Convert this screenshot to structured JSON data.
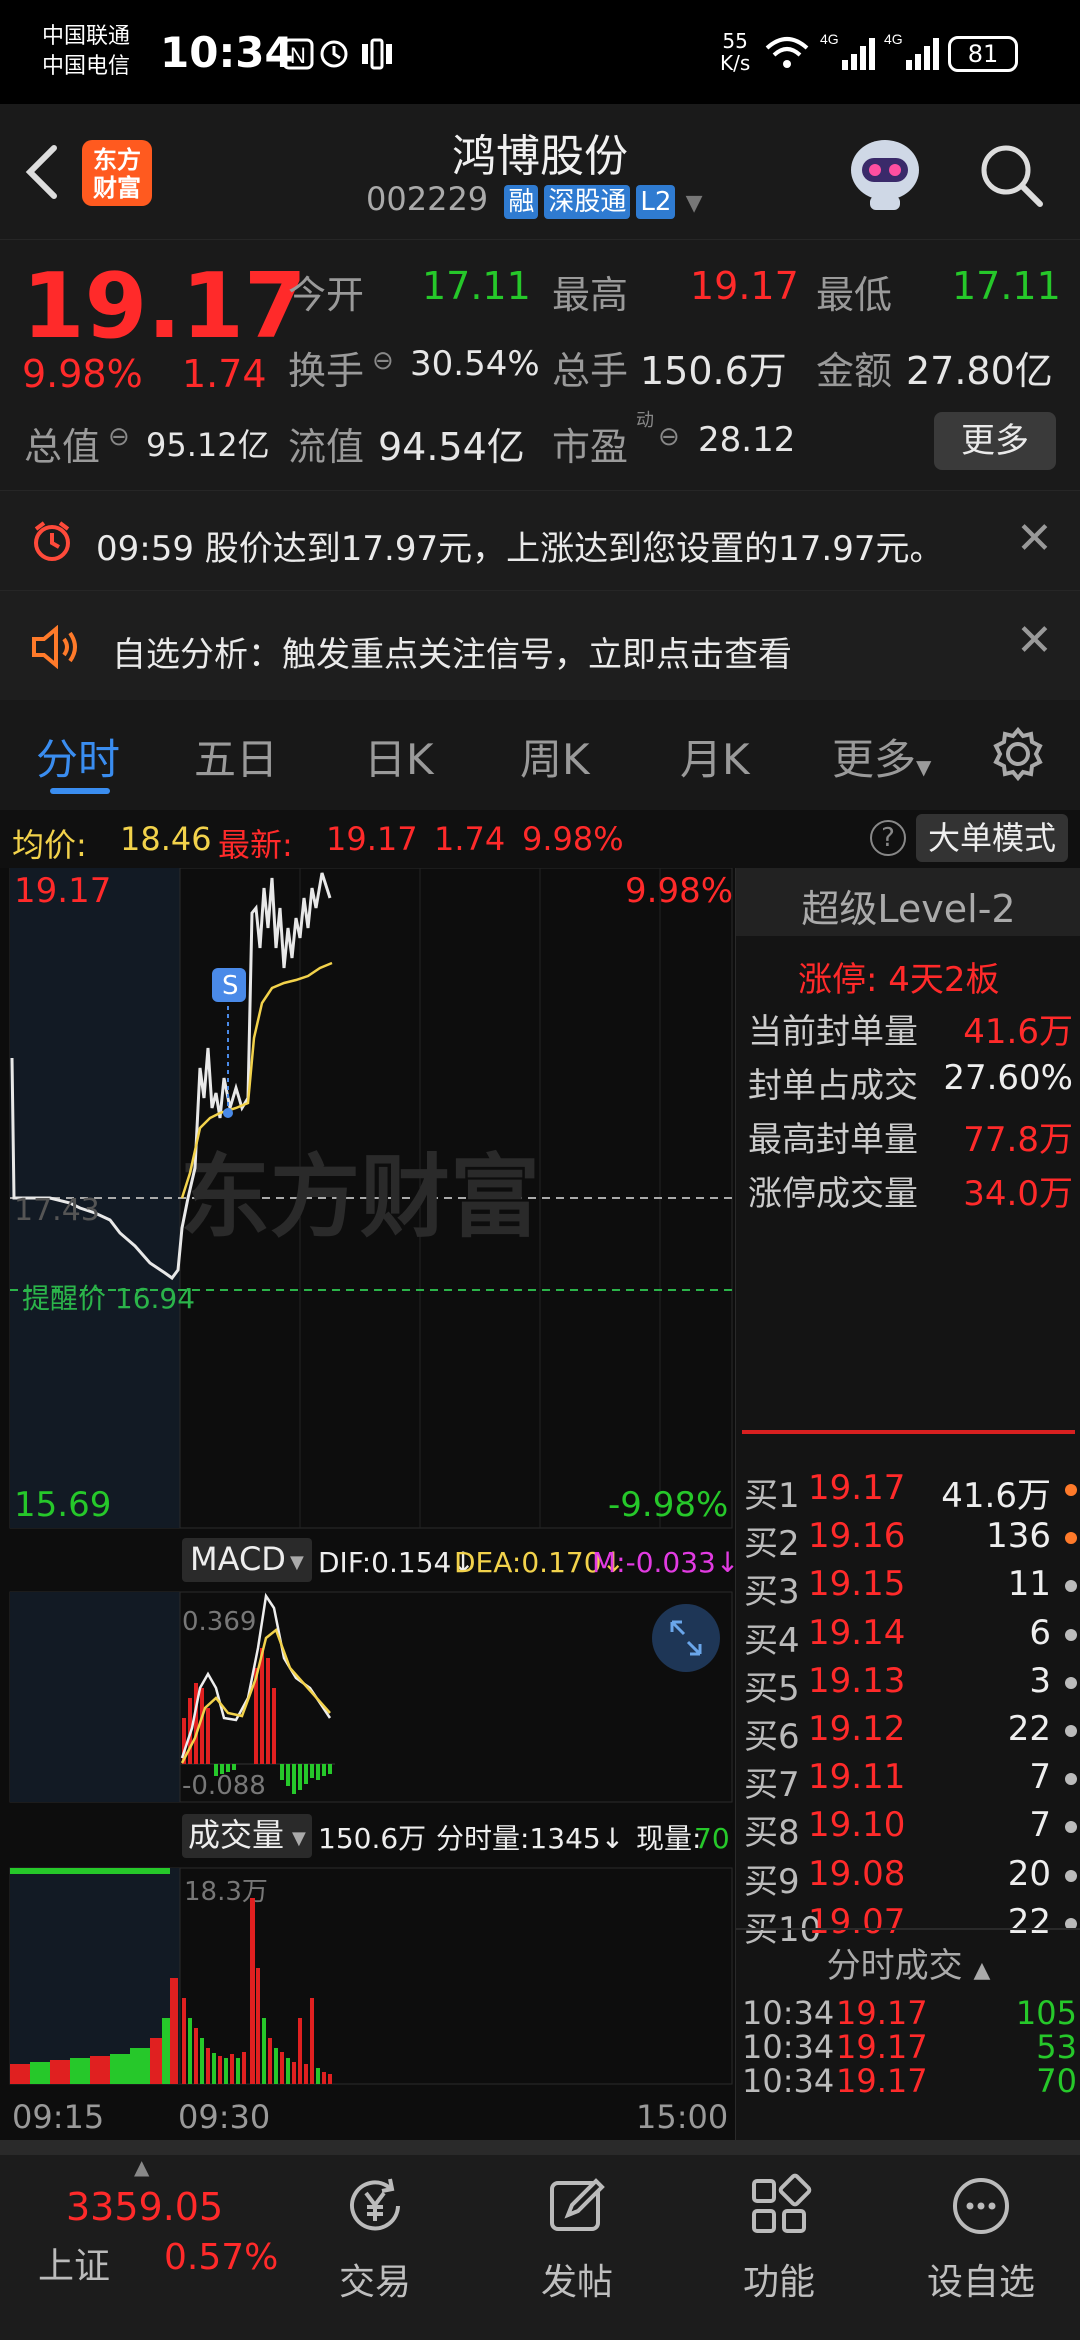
{
  "status_bar": {
    "carrier1": "中国联通",
    "carrier2": "中国电信",
    "time": "10:34",
    "net_speed_value": "55",
    "net_speed_unit": "K/s",
    "battery": "81"
  },
  "header": {
    "logo_line1": "东方",
    "logo_line2": "财富",
    "stock_name": "鸿博股份",
    "stock_code": "002229",
    "tags": [
      "融",
      "深股通",
      "L2"
    ]
  },
  "quote": {
    "price": "19.17",
    "change_pct": "9.98%",
    "change_amt": "1.74",
    "open_label": "今开",
    "open": "17.11",
    "high_label": "最高",
    "high": "19.17",
    "low_label": "最低",
    "low": "17.11",
    "turnover_label": "换手",
    "turnover": "30.54%",
    "volume_label": "总手",
    "volume": "150.6万",
    "amount_label": "金额",
    "amount": "27.80亿",
    "total_mv_label": "总值",
    "total_mv": "95.12亿",
    "float_mv_label": "流值",
    "float_mv": "94.54亿",
    "pe_label": "市盈",
    "pe_sup": "动",
    "pe": "28.12",
    "more_label": "更多"
  },
  "alerts": {
    "price_alert": "09:59 股价达到17.97元，上涨达到您设置的17.97元。",
    "analysis_alert": "自选分析：触发重点关注信号，立即点击查看"
  },
  "tabs": [
    "分时",
    "五日",
    "日K",
    "周K",
    "月K",
    "更多"
  ],
  "infoline": {
    "avg_label": "均价:",
    "avg": "18.46",
    "latest_label": "最新:",
    "latest": "19.17",
    "latest_chg": "1.74",
    "latest_pct": "9.98%",
    "mode_button": "大单模式"
  },
  "chart": {
    "top_price": "19.17",
    "top_pct": "9.98%",
    "bottom_price": "15.69",
    "bottom_pct": "-9.98%",
    "prev_close": "17.43",
    "remind_label": "提醒价 16.94",
    "s_marker": "S",
    "watermark": "东方财富",
    "macd_label": "MACD",
    "dif": "DIF:0.154↓",
    "dea": "DEA:0.170↓",
    "m": "M:-0.033↓",
    "macd_top": "0.369",
    "macd_bottom": "-0.088",
    "vol_label": "成交量",
    "vol_total": "150.6万",
    "vol_minute": "分时量:1345↓",
    "vol_now_label": "现量:",
    "vol_now": "70",
    "vol_max": "18.3万",
    "time_start": "09:15",
    "time_mid": "09:30",
    "time_end": "15:00"
  },
  "level2": {
    "title": "超级Level-2",
    "limit_up": "涨停:  4天2板",
    "rows": [
      {
        "label": "当前封单量",
        "value": "41.6万"
      },
      {
        "label": "封单占成交",
        "value": "27.60%"
      },
      {
        "label": "最高封单量",
        "value": "77.8万"
      },
      {
        "label": "涨停成交量",
        "value": "34.0万"
      }
    ]
  },
  "order_book": [
    {
      "label": "买1",
      "price": "19.17",
      "vol": "41.6万"
    },
    {
      "label": "买2",
      "price": "19.16",
      "vol": "136"
    },
    {
      "label": "买3",
      "price": "19.15",
      "vol": "11"
    },
    {
      "label": "买4",
      "price": "19.14",
      "vol": "6"
    },
    {
      "label": "买5",
      "price": "19.13",
      "vol": "3"
    },
    {
      "label": "买6",
      "price": "19.12",
      "vol": "22"
    },
    {
      "label": "买7",
      "price": "19.11",
      "vol": "7"
    },
    {
      "label": "买8",
      "price": "19.10",
      "vol": "7"
    },
    {
      "label": "买9",
      "price": "19.08",
      "vol": "20"
    },
    {
      "label": "买10",
      "price": "19.07",
      "vol": "22"
    }
  ],
  "trades_title": "分时成交",
  "trades": [
    {
      "time": "10:34",
      "price": "19.17",
      "vol": "105"
    },
    {
      "time": "10:34",
      "price": "19.17",
      "vol": "53"
    },
    {
      "time": "10:34",
      "price": "19.17",
      "vol": "70"
    }
  ],
  "bottom_nav": {
    "index_value": "3359.05",
    "index_name": "上证",
    "index_pct": "0.57%",
    "items": [
      "交易",
      "发帖",
      "功能",
      "设自选"
    ]
  },
  "colors": {
    "up": "#ff2a2a",
    "down": "#26c82a",
    "avg_line": "#f2d24b",
    "accent": "#3a8df0",
    "logo": "#ff5a1f"
  }
}
